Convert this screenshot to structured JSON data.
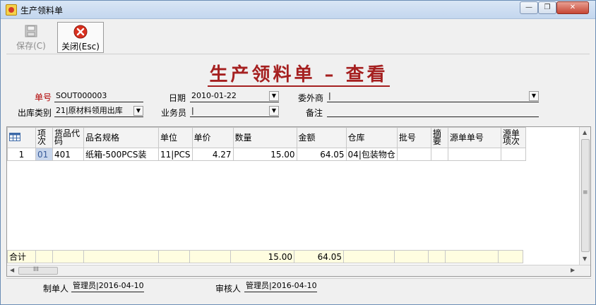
{
  "window": {
    "title": "生产领料单",
    "min": "—",
    "max": "❐",
    "close": "✕"
  },
  "toolbar": {
    "save_label": "保存(C)",
    "close_label": "关闭(Esc)"
  },
  "page_title": "生产领料单 – 查看",
  "form": {
    "order_no_label": "单号",
    "order_no": "SOUT000003",
    "date_label": "日期",
    "date": "2010-01-22",
    "subcontractor_label": "委外商",
    "subcontractor": "|",
    "out_type_label": "出库类别",
    "out_type": "21|原材料领用出库",
    "salesman_label": "业务员",
    "salesman": "|",
    "remark_label": "备注",
    "remark": ""
  },
  "table": {
    "headers": [
      "项次",
      "货品代码",
      "品名规格",
      "单位",
      "单价",
      "数量",
      "金额",
      "仓库",
      "批号",
      "摘要",
      "源单单号",
      "源单项次"
    ],
    "rows": [
      {
        "row_no": "1",
        "item": "01",
        "code": "401",
        "name": "纸箱-500PCS装",
        "unit": "11|PCS",
        "price": "4.27",
        "qty": "15.00",
        "amount": "64.05",
        "warehouse": "04|包装物仓",
        "batch": "",
        "summary": "",
        "src_no": "",
        "src_item": ""
      }
    ],
    "total_label": "合计",
    "total_qty": "15.00",
    "total_amount": "64.05"
  },
  "footer": {
    "maker_label": "制单人",
    "maker": "管理员|2016-04-10",
    "auditor_label": "审核人",
    "auditor": "管理员|2016-04-10"
  },
  "scrollbar": {
    "grip": "≡",
    "h_grip": "III"
  }
}
